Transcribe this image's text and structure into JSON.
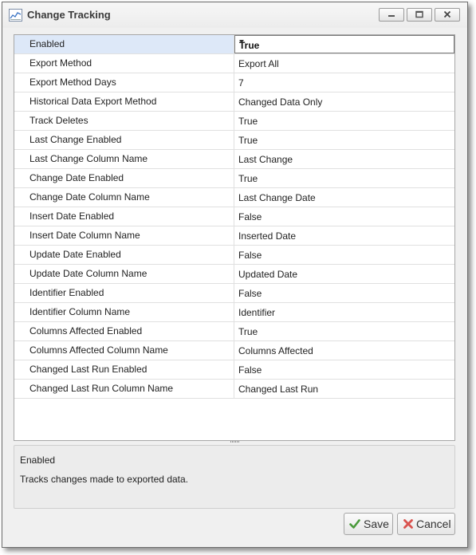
{
  "window": {
    "title": "Change Tracking"
  },
  "grid": {
    "rows": [
      {
        "name": "Enabled",
        "value": "True"
      },
      {
        "name": "Export Method",
        "value": "Export All"
      },
      {
        "name": "Export Method Days",
        "value": "7"
      },
      {
        "name": "Historical Data Export Method",
        "value": "Changed Data Only"
      },
      {
        "name": "Track Deletes",
        "value": "True"
      },
      {
        "name": "Last Change Enabled",
        "value": "True"
      },
      {
        "name": "Last Change Column Name",
        "value": "Last Change"
      },
      {
        "name": "Change Date Enabled",
        "value": "True"
      },
      {
        "name": "Change Date Column Name",
        "value": "Last Change Date"
      },
      {
        "name": "Insert Date Enabled",
        "value": "False"
      },
      {
        "name": "Insert Date Column Name",
        "value": "Inserted Date"
      },
      {
        "name": "Update Date Enabled",
        "value": "False"
      },
      {
        "name": "Update Date Column Name",
        "value": "Updated Date"
      },
      {
        "name": "Identifier Enabled",
        "value": "False"
      },
      {
        "name": "Identifier Column Name",
        "value": "Identifier"
      },
      {
        "name": "Columns Affected Enabled",
        "value": "True"
      },
      {
        "name": "Columns Affected Column Name",
        "value": "Columns Affected"
      },
      {
        "name": "Changed Last Run Enabled",
        "value": "False"
      },
      {
        "name": "Changed Last Run Column Name",
        "value": "Changed Last Run"
      }
    ]
  },
  "description": {
    "title": "Enabled",
    "text": "Tracks changes made to exported data."
  },
  "buttons": {
    "save_label": "Save",
    "cancel_label": "Cancel"
  },
  "colors": {
    "selected_row": "#dde8f8",
    "save_icon": "#4a9a3b",
    "cancel_icon": "#d9534f"
  },
  "icons": {
    "app": "chart-icon",
    "minimize": "minimize-icon",
    "maximize": "maximize-icon",
    "close": "close-icon",
    "save": "checkmark-icon",
    "cancel": "x-icon",
    "dropdown": "chevron-down-icon"
  }
}
